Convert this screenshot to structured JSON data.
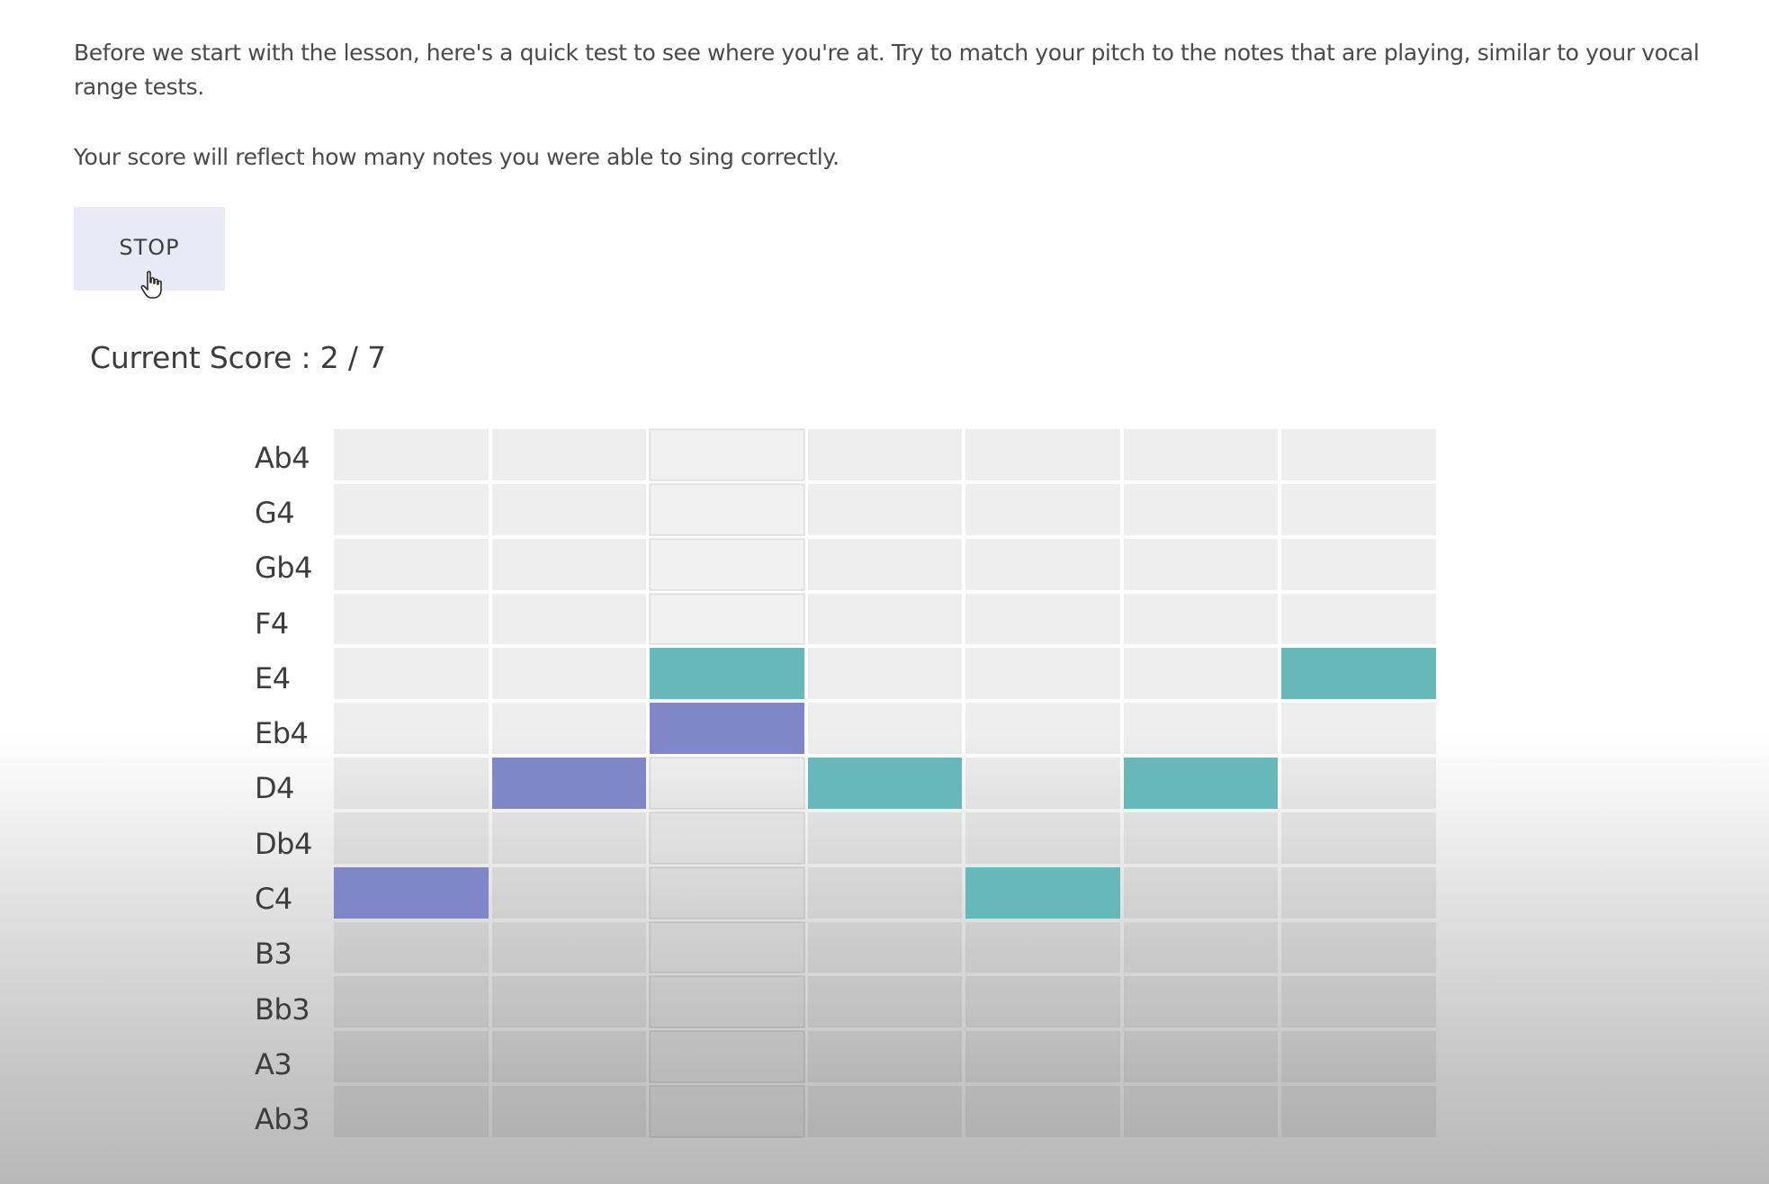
{
  "intro": {
    "paragraph_1": "Before we start with the lesson, here's a quick test to see where you're at. Try to match your pitch to the notes that are playing, similar to your vocal range tests.",
    "paragraph_2": "Your score will reflect how many notes you were able to sing correctly."
  },
  "controls": {
    "stop_label": "STOP"
  },
  "score": {
    "label": "Current Score :",
    "correct": "2",
    "separator": " / ",
    "total": "7"
  },
  "pitch_grid": {
    "pitches": [
      "Ab4",
      "G4",
      "Gb4",
      "F4",
      "E4",
      "Eb4",
      "D4",
      "Db4",
      "C4",
      "B3",
      "Bb3",
      "A3",
      "Ab3"
    ],
    "column_count": 7,
    "active_column": 3,
    "target_notes": [
      {
        "column": 1,
        "pitch": "C4"
      },
      {
        "column": 2,
        "pitch": "D4"
      },
      {
        "column": 3,
        "pitch": "Eb4"
      }
    ],
    "sung_notes": [
      {
        "column": 3,
        "pitch": "E4"
      },
      {
        "column": 4,
        "pitch": "D4"
      },
      {
        "column": 5,
        "pitch": "C4"
      },
      {
        "column": 6,
        "pitch": "D4"
      },
      {
        "column": 7,
        "pitch": "E4"
      }
    ],
    "colors": {
      "target": "#7f87c8",
      "sung": "#66b9b8",
      "cell": "#eeeeee"
    }
  }
}
